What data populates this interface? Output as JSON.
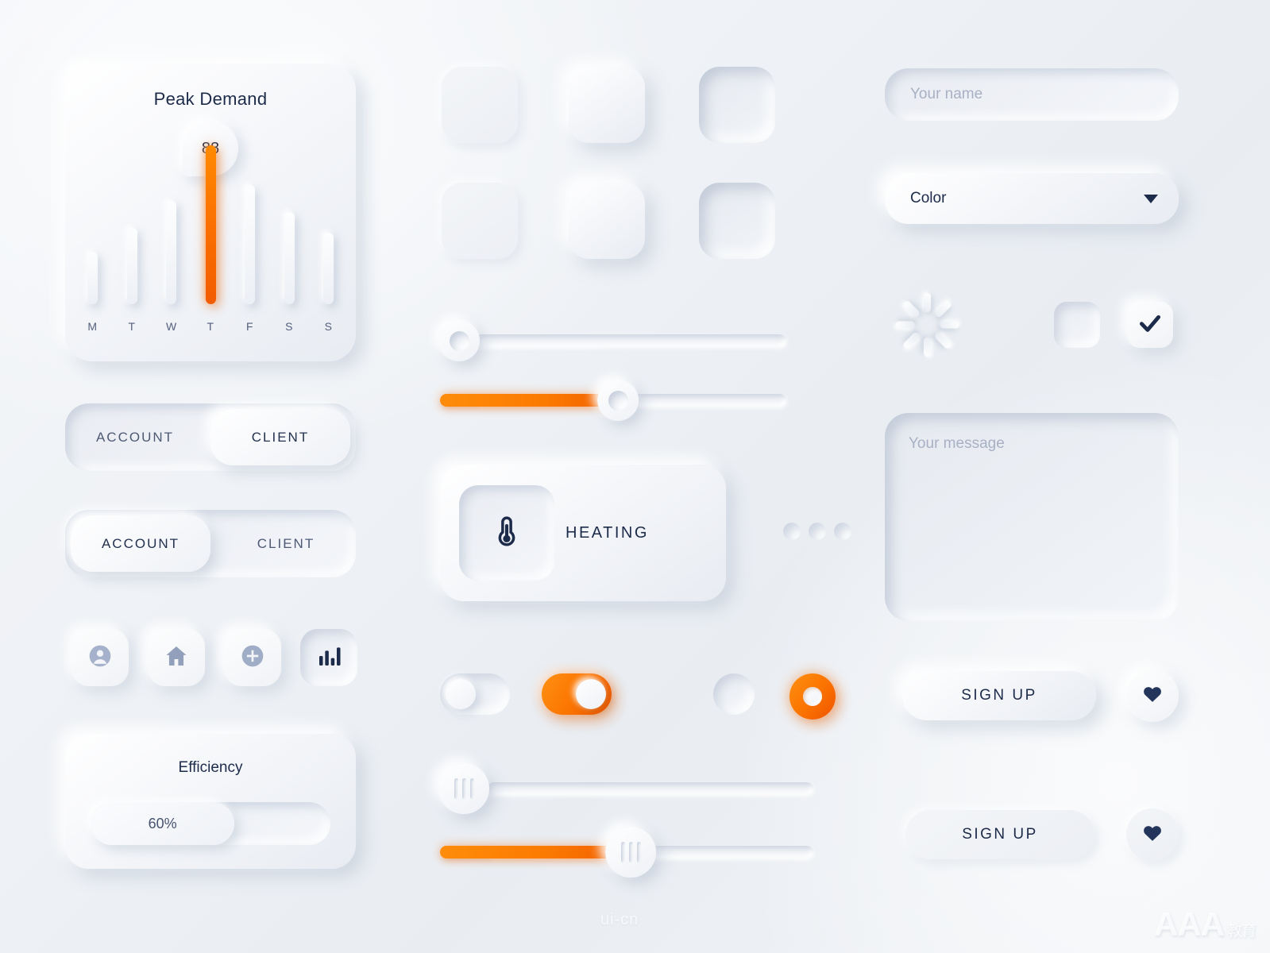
{
  "peak_card": {
    "title": "Peak Demand",
    "value": "88",
    "chart_data": {
      "type": "bar",
      "title": "Peak Demand",
      "categories": [
        "M",
        "T",
        "W",
        "T",
        "F",
        "S",
        "S"
      ],
      "values": [
        33,
        48,
        65,
        100,
        75,
        58,
        45
      ],
      "highlight_index": 3,
      "highlight_value": "88",
      "xlabel": "",
      "ylabel": "",
      "ylim": [
        0,
        100
      ],
      "grid": false,
      "legend": "none",
      "highlight_color": "#fb7100",
      "bar_color": "#f0f3f8"
    }
  },
  "tabs_raised": {
    "items": [
      {
        "label": "ACCOUNT",
        "active": false
      },
      {
        "label": "CLIENT",
        "active": true
      }
    ]
  },
  "tabs_inset": {
    "items": [
      {
        "label": "ACCOUNT",
        "active": true
      },
      {
        "label": "CLIENT",
        "active": false
      }
    ]
  },
  "icon_buttons": [
    {
      "name": "user-icon",
      "state": "normal"
    },
    {
      "name": "home-icon",
      "state": "normal"
    },
    {
      "name": "plus-circle-icon",
      "state": "normal"
    },
    {
      "name": "bar-chart-icon",
      "state": "active"
    }
  ],
  "efficiency": {
    "title": "Efficiency",
    "value_label": "60%",
    "percent": 60
  },
  "squares": [
    {
      "style": "flat"
    },
    {
      "style": "raised"
    },
    {
      "style": "inset"
    },
    {
      "style": "flat"
    },
    {
      "style": "raised"
    },
    {
      "style": "inset"
    }
  ],
  "sliders": [
    {
      "name": "slider-ring-empty",
      "value": 0,
      "filled": false,
      "knob": "ring"
    },
    {
      "name": "slider-ring-half",
      "value": 50,
      "filled": true,
      "knob": "ring"
    },
    {
      "name": "slider-grip-empty",
      "value": 0,
      "filled": false,
      "knob": "grip"
    },
    {
      "name": "slider-grip-half",
      "value": 50,
      "filled": true,
      "knob": "grip"
    }
  ],
  "heating": {
    "label": "HEATING",
    "icon": "thermometer-icon"
  },
  "pagination_dots": 3,
  "toggles": [
    {
      "name": "toggle-off",
      "on": false
    },
    {
      "name": "toggle-on",
      "on": true
    }
  ],
  "radios": [
    {
      "name": "radio-unchecked",
      "checked": false
    },
    {
      "name": "radio-checked",
      "checked": true
    }
  ],
  "form": {
    "name_placeholder": "Your name",
    "name_value": "",
    "select_label": "Color",
    "select_options": [
      "Color"
    ],
    "message_placeholder": "Your message",
    "message_value": ""
  },
  "checkboxes": [
    {
      "name": "checkbox-unchecked",
      "checked": false
    },
    {
      "name": "checkbox-checked",
      "checked": true
    }
  ],
  "buttons": {
    "signup_raised": "SIGN UP",
    "signup_flat": "SIGN UP",
    "heart_icon": "heart-icon"
  },
  "spinner": {
    "name": "loading-spinner-icon",
    "spokes": 8
  },
  "watermarks": {
    "center": "ui-cn",
    "corner": "AAA",
    "corner_sub": "教育"
  },
  "colors": {
    "accent": "#fb7100",
    "accent_light": "#ff9012",
    "accent_dark": "#ef5400",
    "text_navy": "#1d2b4a",
    "text_gray": "#a8b0c4",
    "surface": "#eef1f6"
  }
}
